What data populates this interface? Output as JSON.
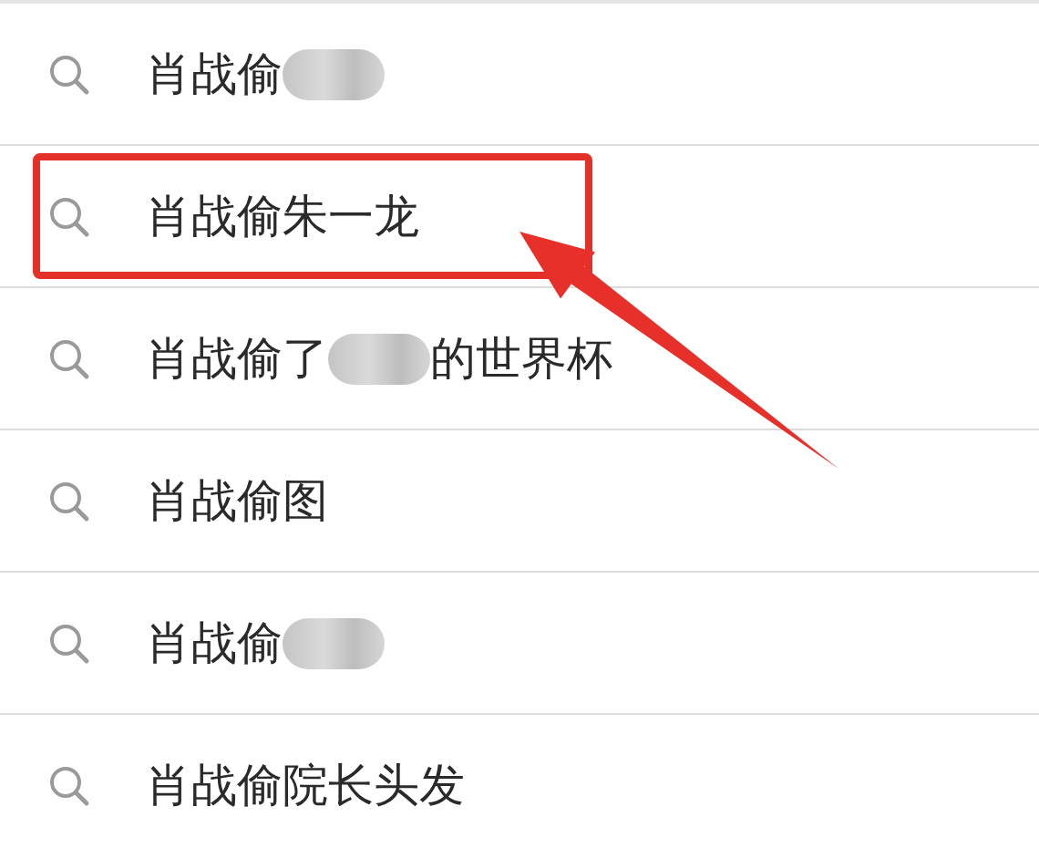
{
  "suggestions": [
    {
      "prefix": "肖战偷",
      "redacted": true,
      "highlighted": false
    },
    {
      "prefix": "肖战偷朱一龙",
      "redacted": false,
      "highlighted": true
    },
    {
      "prefix": "肖战偷了",
      "redacted": true,
      "suffix": "的世界杯",
      "highlighted": false
    },
    {
      "prefix": "肖战偷图",
      "redacted": false,
      "highlighted": false
    },
    {
      "prefix": "肖战偷",
      "redacted": true,
      "highlighted": false
    },
    {
      "prefix": "肖战偷院长头发",
      "redacted": false,
      "highlighted": false
    }
  ]
}
